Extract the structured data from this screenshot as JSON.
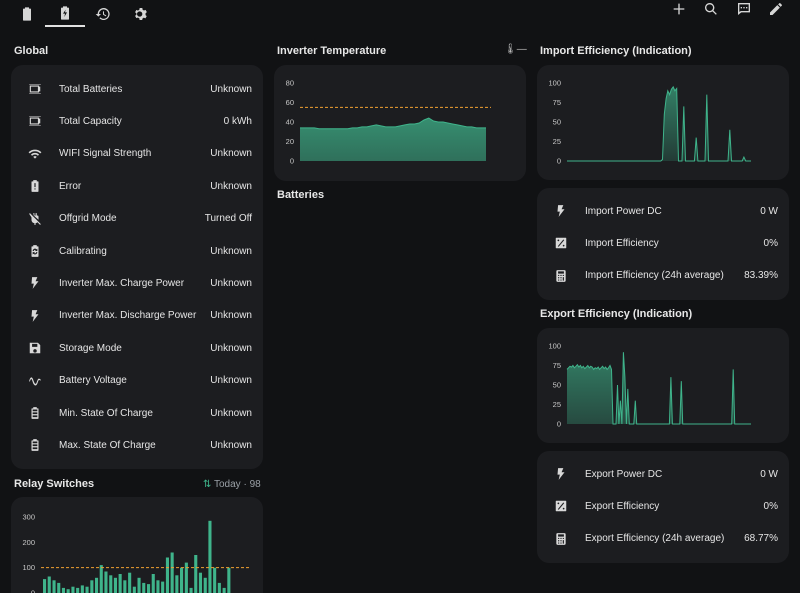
{
  "toolbar": {
    "tabs": [
      {
        "icon": "battery-icon"
      },
      {
        "icon": "battery-charging-icon",
        "active": true
      },
      {
        "icon": "history-icon"
      },
      {
        "icon": "gear-icon"
      }
    ],
    "actions": [
      "plus-icon",
      "search-icon",
      "chat-icon",
      "pencil-icon"
    ]
  },
  "global": {
    "title": "Global",
    "rows": [
      {
        "icon": "battery-outline-icon",
        "label": "Total Batteries",
        "value": "Unknown"
      },
      {
        "icon": "battery-outline-icon",
        "label": "Total Capacity",
        "value": "0 kWh"
      },
      {
        "icon": "wifi-icon",
        "label": "WIFI Signal Strength",
        "value": "Unknown"
      },
      {
        "icon": "battery-alert-icon",
        "label": "Error",
        "value": "Unknown"
      },
      {
        "icon": "plug-off-icon",
        "label": "Offgrid Mode",
        "value": "Turned Off"
      },
      {
        "icon": "battery-sync-icon",
        "label": "Calibrating",
        "value": "Unknown"
      },
      {
        "icon": "lightning-icon",
        "label": "Inverter Max. Charge Power",
        "value": "Unknown"
      },
      {
        "icon": "lightning-icon",
        "label": "Inverter Max. Discharge Power",
        "value": "Unknown"
      },
      {
        "icon": "floppy-icon",
        "label": "Storage Mode",
        "value": "Unknown"
      },
      {
        "icon": "sine-wave-icon",
        "label": "Battery Voltage",
        "value": "Unknown"
      },
      {
        "icon": "battery-level-icon",
        "label": "Min. State Of Charge",
        "value": "Unknown"
      },
      {
        "icon": "battery-level-icon",
        "label": "Max. State Of Charge",
        "value": "Unknown"
      }
    ]
  },
  "relay": {
    "title": "Relay Switches",
    "meta": "Today · 98"
  },
  "inverter": {
    "title": "Inverter Temperature",
    "batteries_title": "Batteries",
    "legend": "—"
  },
  "import": {
    "title": "Import Efficiency (Indication)",
    "rows": [
      {
        "icon": "lightning-icon",
        "label": "Import Power DC",
        "value": "0 W"
      },
      {
        "icon": "percent-box-icon",
        "label": "Import Efficiency",
        "value": "0%"
      },
      {
        "icon": "calculator-icon",
        "label": "Import Efficiency (24h average)",
        "value": "83.39%"
      }
    ]
  },
  "export": {
    "title": "Export Efficiency (Indication)",
    "rows": [
      {
        "icon": "lightning-icon",
        "label": "Export Power DC",
        "value": "0 W"
      },
      {
        "icon": "percent-box-icon",
        "label": "Export Efficiency",
        "value": "0%"
      },
      {
        "icon": "calculator-icon",
        "label": "Export Efficiency (24h average)",
        "value": "68.77%"
      }
    ]
  },
  "colors": {
    "series": "#3fb48b",
    "threshold": "#f0a030",
    "card": "#1c1d20"
  },
  "chart_data": [
    {
      "type": "area",
      "ylim": [
        0,
        80
      ],
      "yticks": [
        0,
        20,
        40,
        60,
        80
      ],
      "threshold": 55,
      "values": [
        34,
        34,
        34,
        34,
        33,
        33,
        33,
        33,
        33,
        33,
        33,
        34,
        34,
        35,
        35,
        36,
        37,
        36,
        35,
        35,
        35,
        36,
        37,
        38,
        38,
        39,
        42,
        44,
        41,
        40,
        40,
        39,
        38,
        37,
        36,
        35,
        35,
        34,
        34,
        34
      ]
    },
    {
      "type": "area",
      "ylim": [
        0,
        100
      ],
      "yticks": [
        0,
        25,
        50,
        75,
        100
      ],
      "values": [
        0,
        0,
        0,
        0,
        0,
        0,
        0,
        0,
        0,
        0,
        0,
        0,
        0,
        0,
        0,
        0,
        0,
        0,
        0,
        0,
        0,
        0,
        0,
        0,
        0,
        0,
        0,
        0,
        0,
        0,
        0,
        0,
        0,
        0,
        0,
        0,
        0,
        0,
        0,
        0,
        0,
        0,
        0,
        0,
        0,
        0,
        0,
        0,
        0,
        0,
        0,
        0,
        0,
        0,
        2,
        60,
        80,
        90,
        85,
        92,
        95,
        90,
        93,
        0,
        0,
        0,
        70,
        0,
        0,
        0,
        0,
        0,
        0,
        30,
        0,
        0,
        0,
        0,
        0,
        85,
        0,
        0,
        0,
        0,
        0,
        0,
        0,
        0,
        0,
        0,
        0,
        0,
        40,
        0,
        0,
        0,
        0,
        0,
        0,
        0,
        5,
        0,
        0,
        0,
        0
      ]
    },
    {
      "type": "area",
      "ylim": [
        0,
        100
      ],
      "yticks": [
        0,
        25,
        50,
        75,
        100
      ],
      "values": [
        70,
        72,
        74,
        73,
        75,
        72,
        74,
        76,
        73,
        75,
        72,
        74,
        71,
        73,
        75,
        72,
        74,
        73,
        70,
        72,
        71,
        73,
        70,
        72,
        74,
        71,
        73,
        70,
        72,
        75,
        70,
        0,
        0,
        0,
        50,
        0,
        30,
        0,
        92,
        60,
        0,
        45,
        0,
        0,
        0,
        0,
        30,
        0,
        0,
        0,
        0,
        0,
        0,
        0,
        0,
        0,
        0,
        0,
        0,
        0,
        0,
        0,
        0,
        0,
        0,
        0,
        0,
        0,
        0,
        0,
        60,
        0,
        0,
        0,
        0,
        0,
        0,
        55,
        0,
        0,
        0,
        0,
        0,
        0,
        0,
        0,
        0,
        0,
        0,
        0,
        0,
        0,
        0,
        0,
        0,
        0,
        0,
        0,
        0,
        0,
        0,
        0,
        0,
        0,
        0,
        0,
        0,
        0,
        0,
        0,
        0,
        0,
        70,
        0,
        0,
        0,
        0,
        0,
        0,
        0,
        0,
        0,
        0,
        0,
        0
      ]
    },
    {
      "type": "bar",
      "ylim": [
        0,
        300
      ],
      "yticks": [
        0,
        100,
        200,
        300
      ],
      "threshold": 100,
      "values": [
        55,
        65,
        50,
        40,
        20,
        15,
        25,
        20,
        30,
        25,
        50,
        60,
        110,
        85,
        70,
        60,
        75,
        50,
        80,
        25,
        60,
        40,
        35,
        75,
        50,
        45,
        140,
        160,
        70,
        100,
        120,
        20,
        150,
        80,
        60,
        285,
        100,
        40,
        20,
        100
      ]
    }
  ]
}
